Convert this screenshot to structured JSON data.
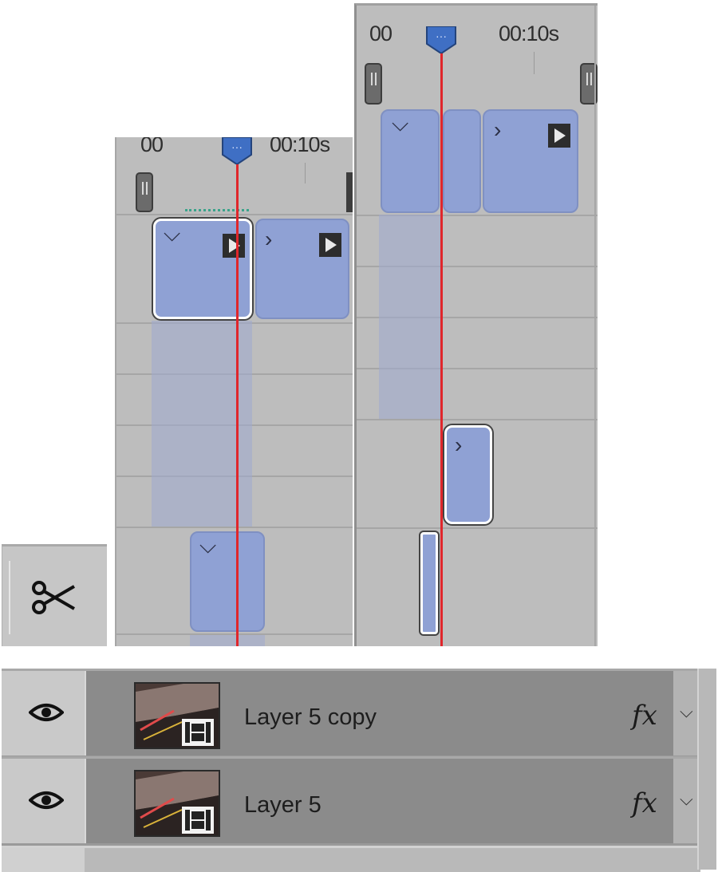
{
  "timeline_left": {
    "start_label": "00",
    "mark_label": "00:10s"
  },
  "timeline_right": {
    "start_label": "00",
    "mark_label": "00:10s"
  },
  "tools": {
    "scissors": "scissors-icon"
  },
  "layers": [
    {
      "name": "Layer 5 copy",
      "fx_label": "fx",
      "visible": true
    },
    {
      "name": "Layer 5",
      "fx_label": "fx",
      "visible": true
    }
  ],
  "colors": {
    "clip_fill": "#8fa1d4",
    "playhead": "#e0262b",
    "playhead_marker": "#3f6fc4",
    "panel_bg": "#bdbdbd"
  }
}
